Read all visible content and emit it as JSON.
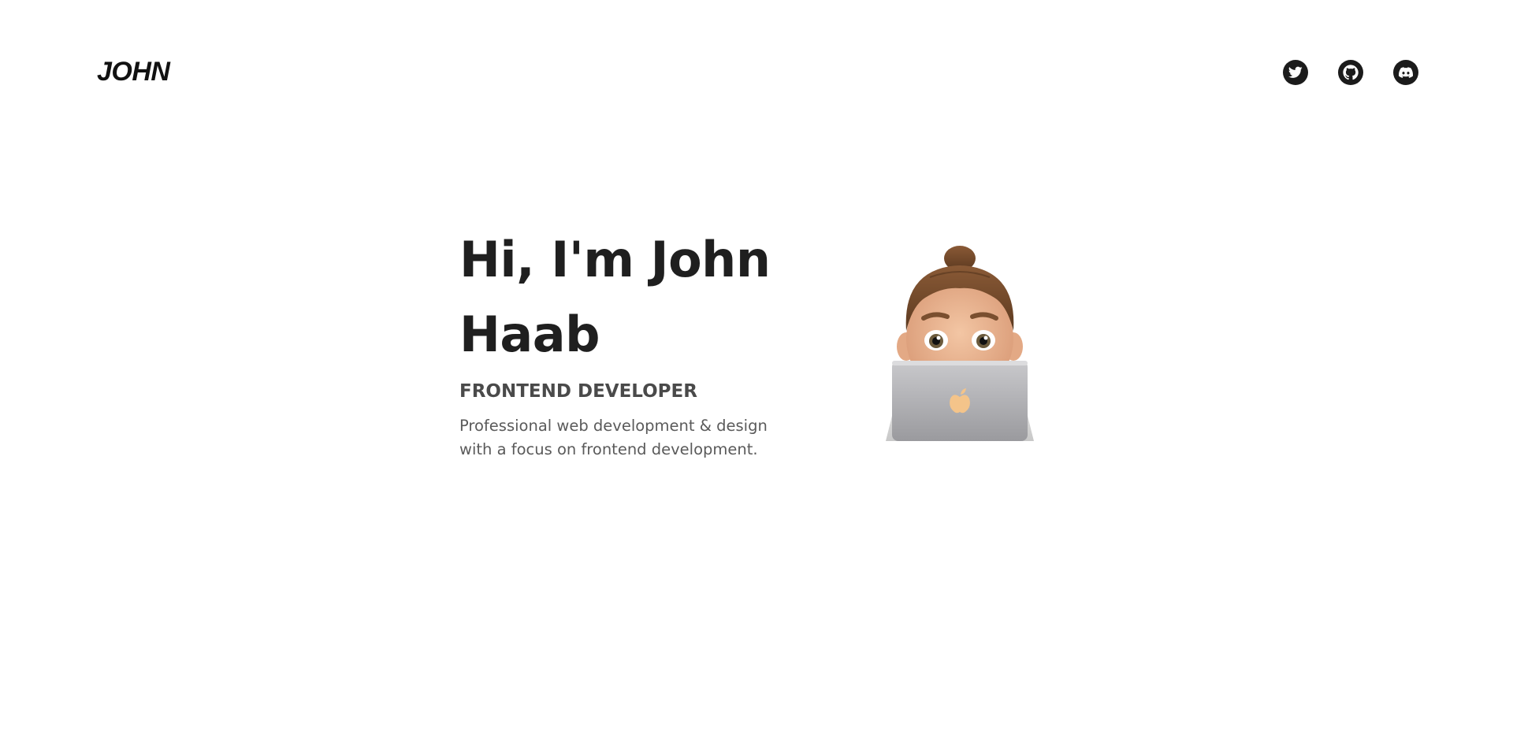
{
  "header": {
    "logo": "JOHN",
    "socials": [
      {
        "name": "twitter-icon"
      },
      {
        "name": "github-icon"
      },
      {
        "name": "discord-icon"
      }
    ]
  },
  "hero": {
    "title_line1": "Hi, I'm John",
    "title_line2": "Haab",
    "role": "FRONTEND DEVELOPER",
    "desc_line1": "Professional web development & design",
    "desc_line2": "with a focus on frontend development."
  },
  "colors": {
    "background": "#ffffff",
    "text_dark": "#1f1f1f",
    "text_muted": "#5a5a5a",
    "icon_bg": "#1b1b1b"
  }
}
